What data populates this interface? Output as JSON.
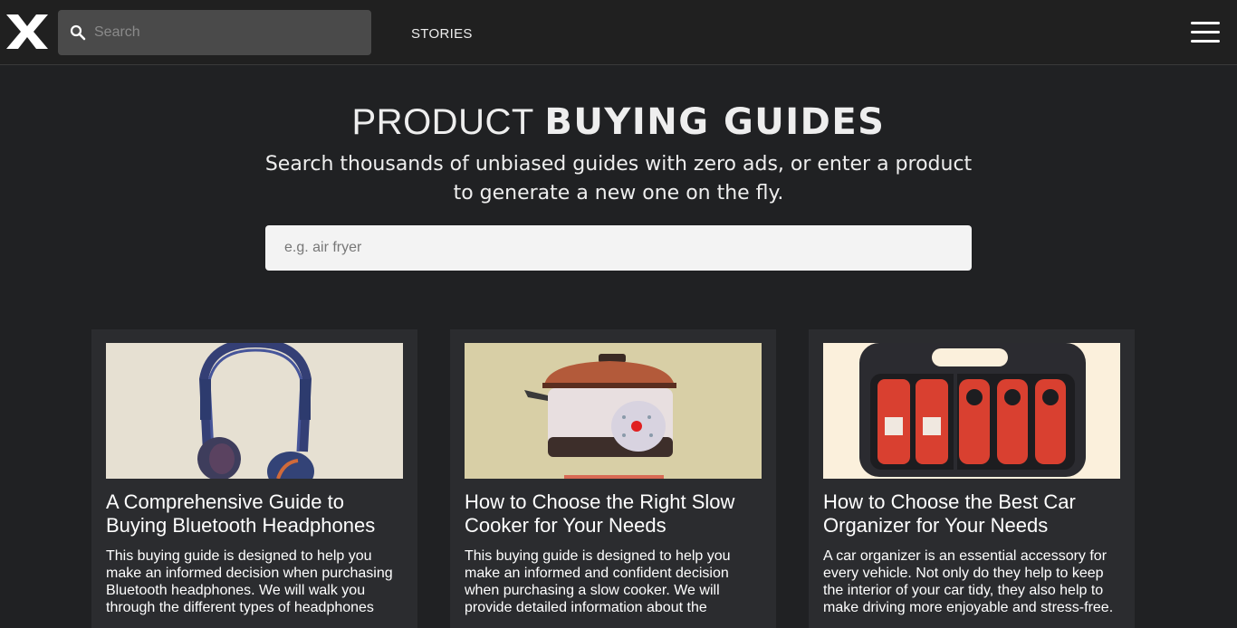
{
  "header": {
    "search_placeholder": "Search",
    "nav_stories": "STORIES"
  },
  "hero": {
    "title_light": "PRODUCT",
    "title_bold": "BUYING GUIDES",
    "subtitle": "Search thousands of unbiased guides with zero ads, or enter a product to generate a new one on the fly.",
    "input_placeholder": "e.g. air fryer"
  },
  "cards": [
    {
      "title": "A Comprehensive Guide to Buying Bluetooth Headphones",
      "description": "This buying guide is designed to help you make an informed decision when purchasing Bluetooth headphones. We will walk you through the different types of headphones",
      "image": "headphones-illustration"
    },
    {
      "title": "How to Choose the Right Slow Cooker for Your Needs",
      "description": "This buying guide is designed to help you make an informed and confident decision when purchasing a slow cooker. We will provide detailed information about the",
      "image": "slow-cooker-illustration"
    },
    {
      "title": "How to Choose the Best Car Organizer for Your Needs",
      "description": "A car organizer is an essential accessory for every vehicle. Not only do they help to keep the interior of your car tidy, they also help to make driving more enjoyable and stress-free.",
      "image": "car-organizer-illustration"
    }
  ],
  "colors": {
    "background": "#202123",
    "card": "#2b2c2f",
    "search_bg": "#4a4a4a"
  }
}
